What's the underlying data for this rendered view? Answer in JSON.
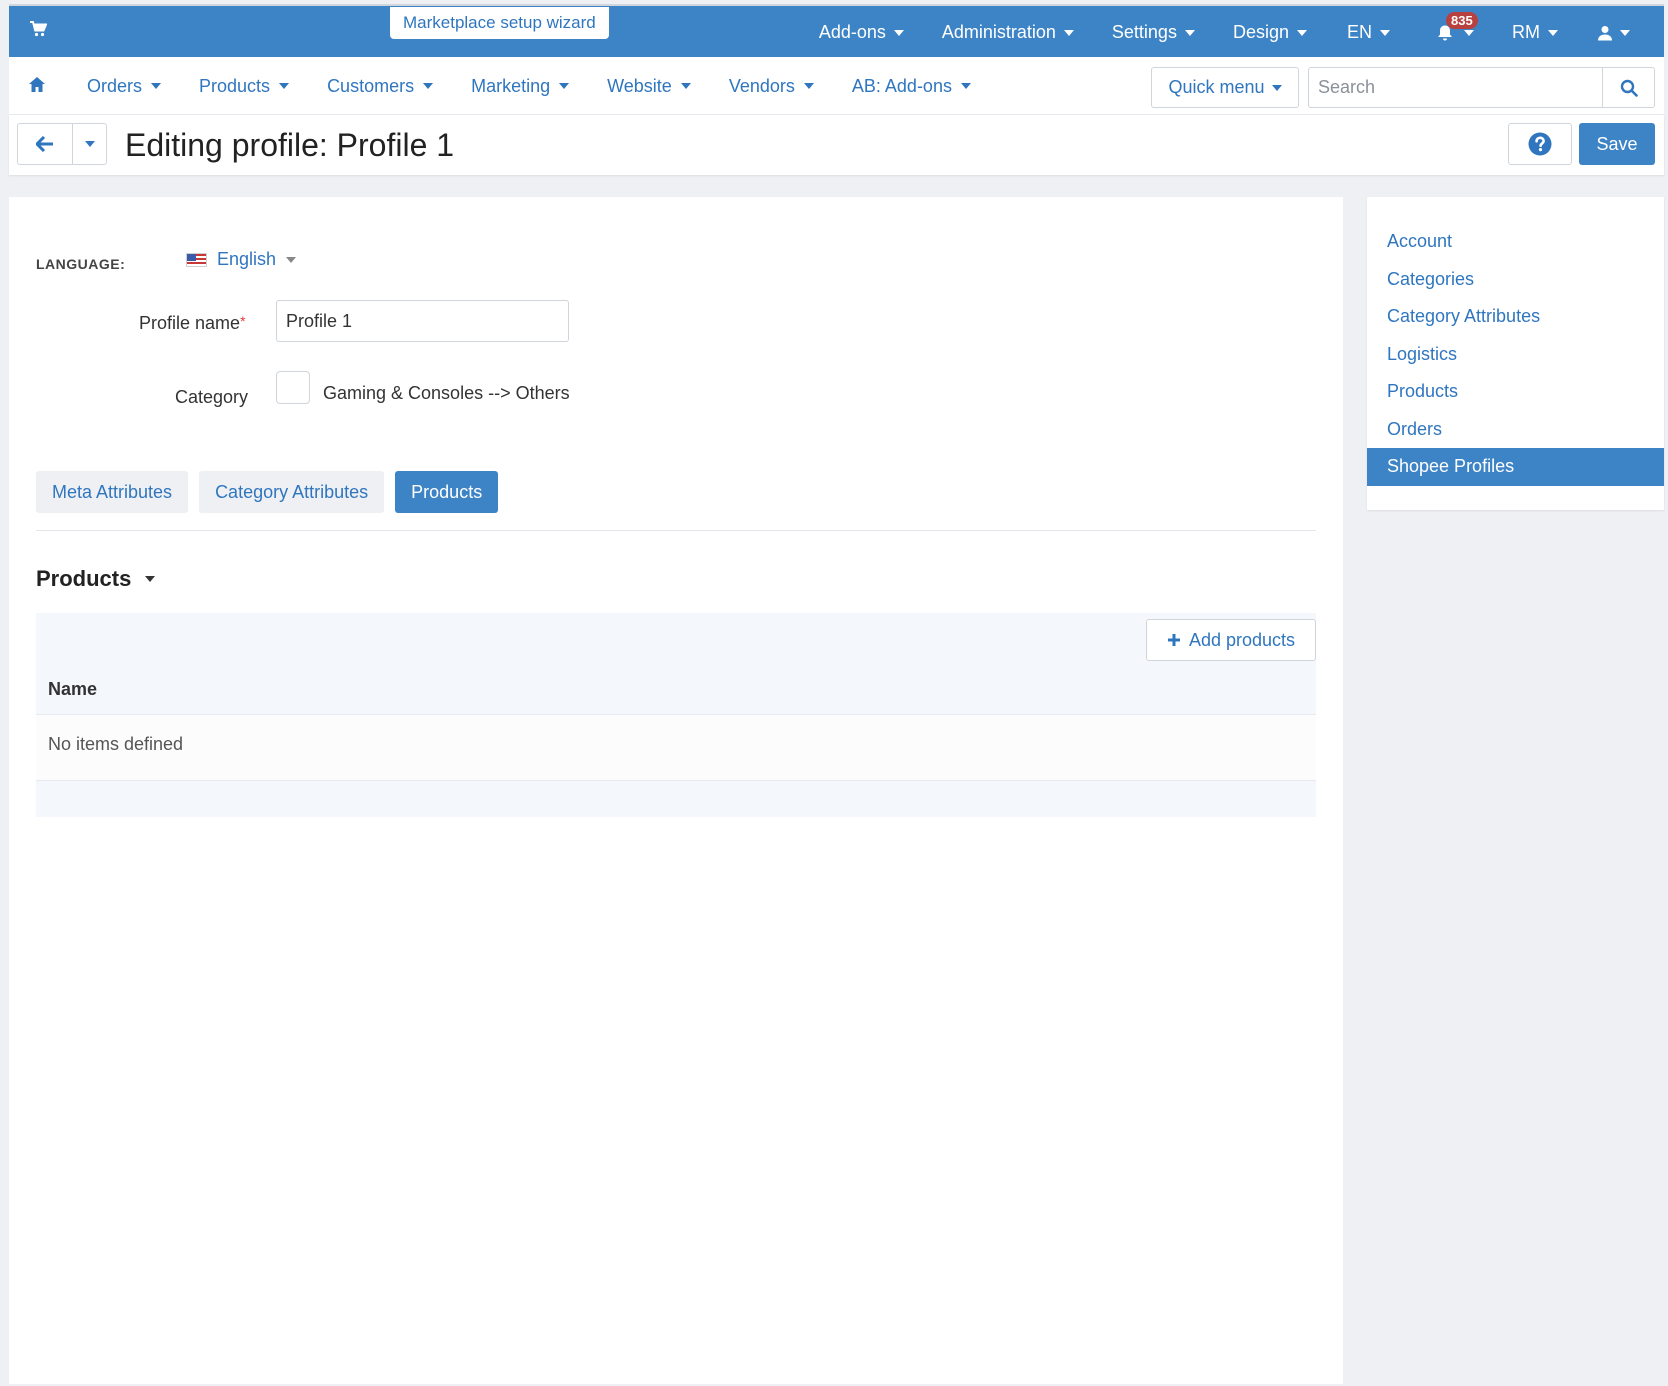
{
  "topbar": {
    "wizard": "Marketplace setup wizard",
    "addons": "Add-ons",
    "administration": "Administration",
    "settings": "Settings",
    "design": "Design",
    "language": "EN",
    "notifications": "835",
    "currency": "RM"
  },
  "nav": {
    "orders": "Orders",
    "products": "Products",
    "customers": "Customers",
    "marketing": "Marketing",
    "website": "Website",
    "vendors": "Vendors",
    "ab_addons": "AB: Add-ons",
    "quick_menu": "Quick menu",
    "search_placeholder": "Search"
  },
  "titlebar": {
    "title": "Editing profile: Profile 1",
    "save": "Save"
  },
  "form": {
    "language_label": "LANGUAGE:",
    "language_value": "English",
    "profile_name_label": "Profile name",
    "required_mark": "*",
    "profile_name_value": "Profile 1",
    "category_label": "Category",
    "category_value": "Gaming & Consoles --> Others"
  },
  "tabs": {
    "meta": "Meta Attributes",
    "category_attributes": "Category Attributes",
    "products": "Products"
  },
  "products_section": {
    "title": "Products",
    "add_button": "Add products",
    "column_name": "Name",
    "empty": "No items defined"
  },
  "sidebar": {
    "items": [
      {
        "label": "Account"
      },
      {
        "label": "Categories"
      },
      {
        "label": "Category Attributes"
      },
      {
        "label": "Logistics"
      },
      {
        "label": "Products"
      },
      {
        "label": "Orders"
      },
      {
        "label": "Shopee Profiles"
      }
    ],
    "active_index": 6
  },
  "colors": {
    "primary": "#3d84c6",
    "link": "#2f76bf",
    "badge": "#b8413f"
  }
}
